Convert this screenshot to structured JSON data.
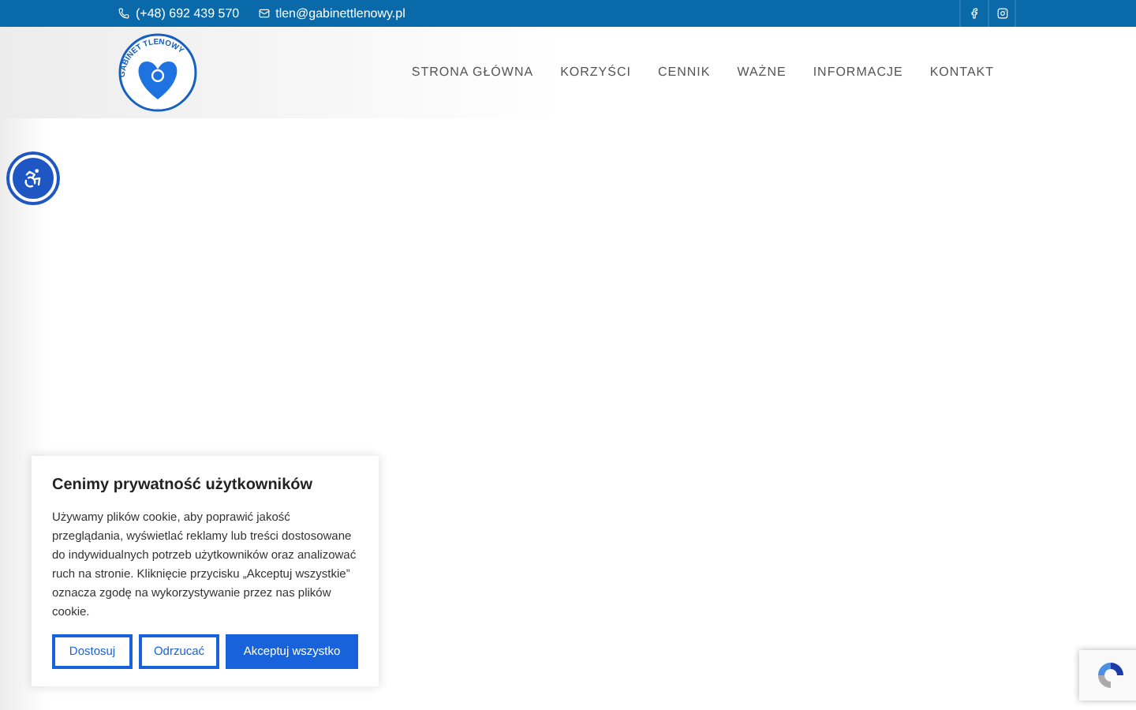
{
  "topbar": {
    "phone": "(+48) 692 439 570",
    "email": "tlen@gabinettlenowy.pl"
  },
  "logo": {
    "text": "GABINET TLENOWY"
  },
  "nav": [
    {
      "label": "STRONA GŁÓWNA"
    },
    {
      "label": "KORZYŚCI"
    },
    {
      "label": "CENNIK"
    },
    {
      "label": "WAŻNE"
    },
    {
      "label": "INFORMACJE"
    },
    {
      "label": "KONTAKT"
    }
  ],
  "cookie": {
    "title": "Cenimy prywatność użytkowników",
    "text": "Używamy plików cookie, aby poprawić jakość przeglądania, wyświetlać reklamy lub treści dostosowane do indywidualnych potrzeb użytkowników oraz analizować ruch na stronie. Kliknięcie przycisku „Akceptuj wszystkie” oznacza zgodę na wykorzystywanie przez nas plików cookie.",
    "buttons": [
      {
        "label": "Dostosuj",
        "kind": "outline"
      },
      {
        "label": "Odrzucać",
        "kind": "outline"
      },
      {
        "label": "Akceptuj wszystko",
        "kind": "primary"
      }
    ]
  }
}
